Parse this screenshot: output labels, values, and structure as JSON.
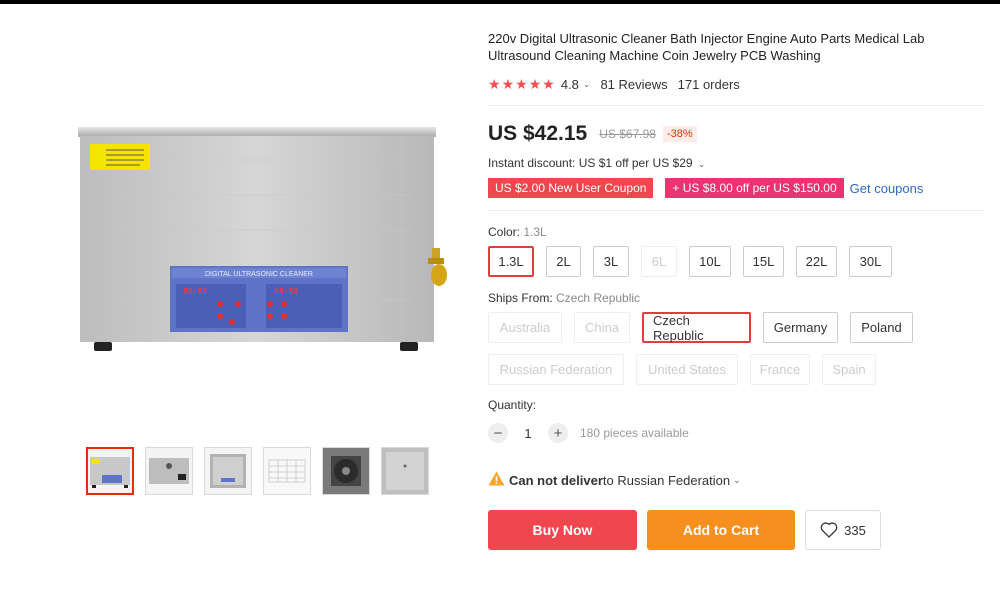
{
  "product": {
    "title": "220v Digital Ultrasonic Cleaner Bath Injector Engine Auto Parts Medical Lab Ultrasound Cleaning Machine Coin Jewelry PCB Washing",
    "rating": "4.8",
    "reviews": "81 Reviews",
    "orders": "171 orders",
    "device_panel_text": "DIGITAL ULTRASONIC CLEANER"
  },
  "price": {
    "current": "US $42.15",
    "original": "US $67.98",
    "discount": "-38%"
  },
  "promo": {
    "instant_discount": "Instant discount: US $1 off per US $29",
    "coupon_new_user": "US $2.00 New User Coupon",
    "coupon_off": "+ US $8.00 off per US $150.00",
    "get_coupons": "Get coupons"
  },
  "color": {
    "label": "Color: ",
    "selected": "1.3L",
    "options": [
      "1.3L",
      "2L",
      "3L",
      "6L",
      "10L",
      "15L",
      "22L",
      "30L"
    ]
  },
  "ships": {
    "label": "Ships From: ",
    "selected": "Czech Republic",
    "options": [
      "Australia",
      "China",
      "Czech Republic",
      "Germany",
      "Poland",
      "Russian Federation",
      "United States",
      "France",
      "Spain"
    ]
  },
  "quantity": {
    "label": "Quantity:",
    "value": "1",
    "available": "180 pieces available",
    "minus": "−",
    "plus": "+"
  },
  "delivery": {
    "bold": "Can not deliver",
    "rest": " to Russian Federation"
  },
  "actions": {
    "buy_now": "Buy Now",
    "add_to_cart": "Add to Cart",
    "wishlist_count": "335"
  },
  "colors": {
    "accent_red": "#f0474f",
    "accent_pink": "#e93470",
    "accent_orange": "#f78f1e",
    "link_blue": "#2e6bc4",
    "star_red": "#f44e4e"
  }
}
